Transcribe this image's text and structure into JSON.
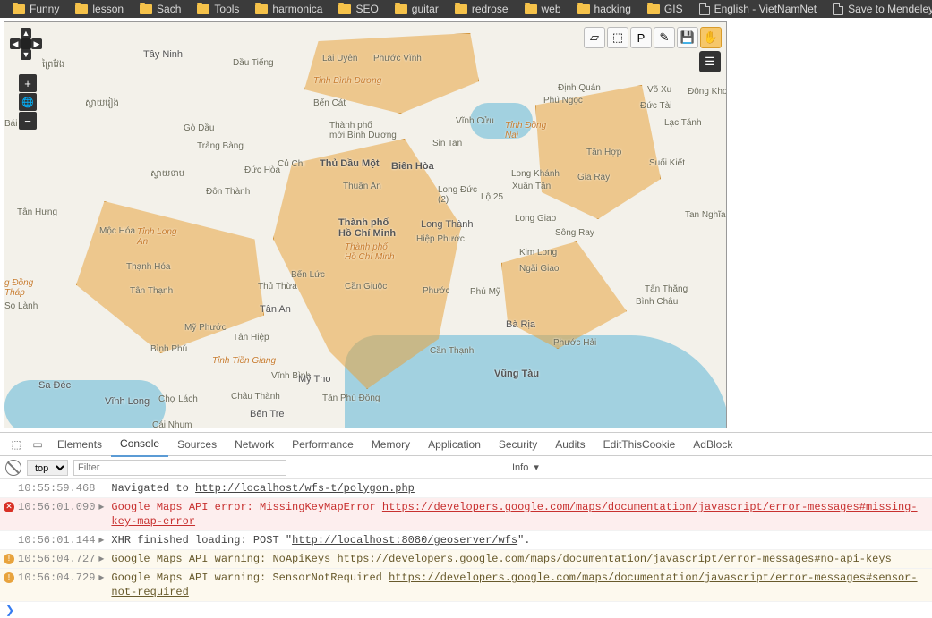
{
  "bookmarks": [
    {
      "label": "Funny",
      "icon": "folder"
    },
    {
      "label": "lesson",
      "icon": "folder"
    },
    {
      "label": "Sach",
      "icon": "folder"
    },
    {
      "label": "Tools",
      "icon": "folder"
    },
    {
      "label": "harmonica",
      "icon": "folder"
    },
    {
      "label": "SEO",
      "icon": "folder"
    },
    {
      "label": "guitar",
      "icon": "folder"
    },
    {
      "label": "redrose",
      "icon": "folder"
    },
    {
      "label": "web",
      "icon": "folder"
    },
    {
      "label": "hacking",
      "icon": "folder"
    },
    {
      "label": "GIS",
      "icon": "folder"
    },
    {
      "label": "English - VietNamNet",
      "icon": "page"
    },
    {
      "label": "Save to Mendeley",
      "icon": "page"
    }
  ],
  "map": {
    "pan": {
      "n": "▲",
      "s": "▼",
      "w": "◀",
      "e": "▶"
    },
    "zoom": {
      "in": "+",
      "globe": "🌐",
      "out": "−"
    },
    "layers_glyph": "☰",
    "tools": [
      {
        "name": "draw-polygon",
        "glyph": "▱"
      },
      {
        "name": "draw-box",
        "glyph": "⬚"
      },
      {
        "name": "draw-point",
        "glyph": "P"
      },
      {
        "name": "edit",
        "glyph": "✎"
      },
      {
        "name": "save",
        "glyph": "💾"
      },
      {
        "name": "pan-hand",
        "glyph": "✋",
        "active": true
      }
    ],
    "labels": {
      "tay_ninh": "Tây Ninh",
      "dau_tieng": "Dầu Tiếng",
      "lai_uyen": "Lai Uyên",
      "phuoc_vinh": "Phước Vĩnh",
      "tinh_binh_duong": "Tỉnh Bình Dương",
      "ben_cat": "Bến Cát",
      "go_dau": "Gò Dầu",
      "cu_chi": "Củ Chi",
      "tp_binh_duong": "Thành phố\nmới Bình Dương",
      "thu_dau_mot": "Thủ Dầu Một",
      "bien_hoa": "Biên Hòa",
      "vinh_cuu": "Vĩnh Cửu",
      "dinh_quan": "Định Quán",
      "phu_ngoc": "Phú Ngọc",
      "vo_xu": "Võ Xu",
      "duc_tai": "Đức Tài",
      "dong_kho": "Đông Kho",
      "lac_tanh": "Lạc Tánh",
      "tinh_dong_nai": "Tỉnh Đồng\nNai",
      "tan_hop": "Tân Hợp",
      "suoi_kiet": "Suối Kiết",
      "gia_ray": "Gia Ray",
      "long_khanh": "Long Khánh",
      "xuan_tan": "Xuân Tân",
      "lo25": "Lộ 25",
      "long_giao": "Long Giao",
      "tan_nghia": "Tan Nghĩa",
      "song_ray": "Sông Ray",
      "kim_long": "Kim Long",
      "ngai_giao": "Ngãi Giao",
      "tan_thang": "Tấn Thắng",
      "binh_chau": "Bình Châu",
      "phuoc_hai": "Phước Hải",
      "vung_tau": "Vũng Tàu",
      "ba_ria": "Bà Rịa",
      "phu_my": "Phú Mỹ",
      "can_thanh": "Cần Thạnh",
      "hiep_phuoc": "Hiệp Phước",
      "long_thanh": "Long Thành",
      "long_duc": "Long Đức\n(2)",
      "thuan_an": "Thuận An",
      "tphcm": "Thành phố\nHồ Chí Minh",
      "tphcm_prov": "Thành phố\nHồ Chí Minh",
      "can_giuoc": "Cần Giuộc",
      "ben_luc": "Bến Lức",
      "thu_thua": "Thủ Thừa",
      "tan_an": "Tân An",
      "tan_hiep": "Tân Hiệp",
      "tinh_tien_giang": "Tỉnh Tiền Giang",
      "my_phuoc": "Mỹ Phước",
      "binh_phu": "Bình Phú",
      "tan_phu_dong": "Tân Phú Đông",
      "vinh_binh": "Vĩnh Bình",
      "cho_lach": "Chợ Lách",
      "vinh_long": "Vĩnh Long",
      "sa_dec": "Sa Đéc",
      "sin_tan": "Sin Tan",
      "duc_hoa": "Đức Hòa",
      "tinh_long_an": "Tỉnh Long\nAn",
      "thanh_hoa": "Thạnh Hóa",
      "tan_thanh": "Tân Thạnh",
      "moc_hoa": "Mộc Hóa",
      "tan_hung": "Tân Hưng",
      "dong_thap": "g Đồng\nTháp",
      "cai_nhum": "Cái Nhum",
      "ben_tre": "Bến Tre",
      "chau_thanh": "Châu Thành",
      "so_lanh": "So Lành",
      "bai_xu": "Bái Xu",
      "trang_bang": "Trảng Bàng",
      "don_thanh": "Đôn Thành",
      "phuoc": "Phước",
      "cuchidist": "Cù Chi",
      "cambodia1": "ស្វាយរៀង",
      "cambodia2": "ព្រៃវែង",
      "cambodia3": "ស្វាយទាប",
      "my_tho": "Mỹ Tho"
    }
  },
  "devtools": {
    "tabs": [
      "Elements",
      "Console",
      "Sources",
      "Network",
      "Performance",
      "Memory",
      "Application",
      "Security",
      "Audits",
      "EditThisCookie",
      "AdBlock"
    ],
    "active_tab": "Console",
    "context": "top",
    "filter_placeholder": "Filter",
    "levels_label": "Info",
    "logs": [
      {
        "time": "10:55:59.468",
        "type": "info",
        "arrow": false,
        "msg": "Navigated to ",
        "link": "http://localhost/wfs-t/polygon.php"
      },
      {
        "time": "10:56:01.090",
        "type": "error",
        "arrow": true,
        "msg": "Google Maps API error: MissingKeyMapError ",
        "link": "https://developers.google.com/maps/documentation/javascript/error-messages#missing-key-map-error"
      },
      {
        "time": "10:56:01.144",
        "type": "info",
        "arrow": true,
        "msg": "XHR finished loading: POST \"",
        "link": "http://localhost:8080/geoserver/wfs",
        "suffix": "\"."
      },
      {
        "time": "10:56:04.727",
        "type": "warn",
        "arrow": true,
        "msg": "Google Maps API warning: NoApiKeys ",
        "link": "https://developers.google.com/maps/documentation/javascript/error-messages#no-api-keys"
      },
      {
        "time": "10:56:04.729",
        "type": "warn",
        "arrow": true,
        "msg": "Google Maps API warning: SensorNotRequired ",
        "link": "https://developers.google.com/maps/documentation/javascript/error-messages#sensor-not-required"
      }
    ],
    "prompt": "❯"
  }
}
